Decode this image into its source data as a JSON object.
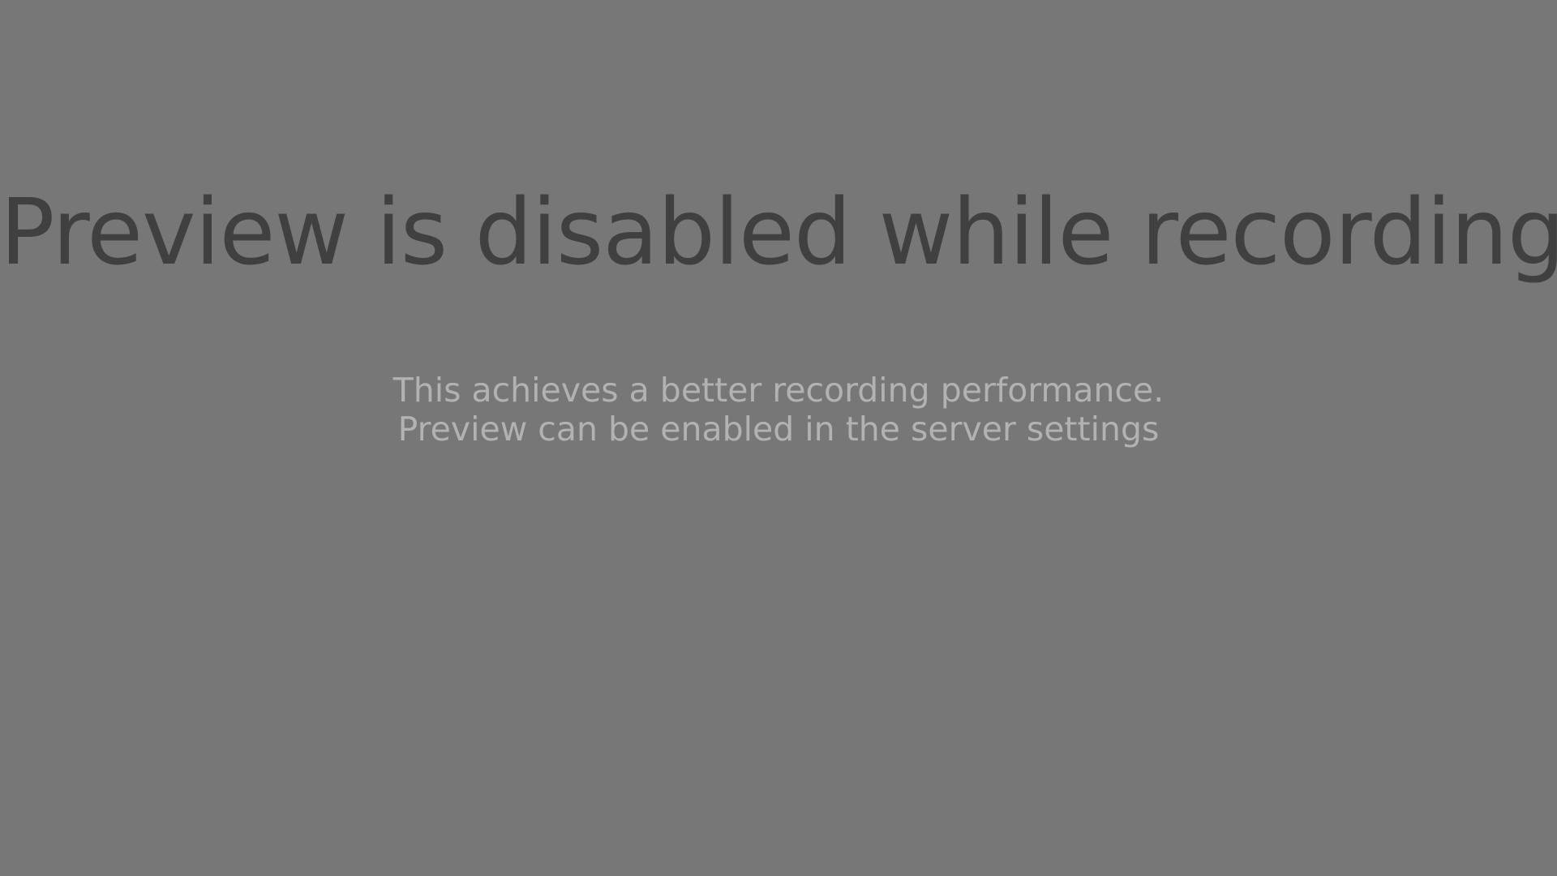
{
  "colors": {
    "background": "#777777",
    "headline": "#404040",
    "subtext": "#b2b2b2"
  },
  "notice": {
    "title": "Preview is disabled while recording",
    "lines": [
      "This achieves a better recording performance.",
      "Preview can be enabled in the server settings"
    ]
  }
}
